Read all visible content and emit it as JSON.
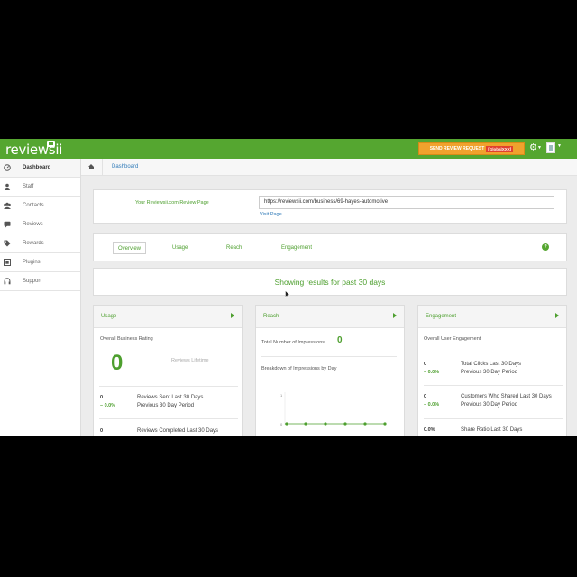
{
  "header": {
    "logo": "reviewsii",
    "send_button": "SEND REVIEW REQUEST",
    "send_tag": "[GlobalXXX]"
  },
  "sidebar": {
    "items": [
      {
        "label": "Dashboard",
        "icon": "dashboard-icon"
      },
      {
        "label": "Staff",
        "icon": "user-icon"
      },
      {
        "label": "Contacts",
        "icon": "contacts-icon"
      },
      {
        "label": "Reviews",
        "icon": "chat-icon"
      },
      {
        "label": "Rewards",
        "icon": "tag-icon"
      },
      {
        "label": "Plugins",
        "icon": "plugin-icon"
      },
      {
        "label": "Support",
        "icon": "headset-icon"
      }
    ]
  },
  "breadcrumb": {
    "current": "Dashboard"
  },
  "review_page": {
    "label": "Your Reviewsii.com Review Page",
    "url": "https://reviewsii.com/business/69-hayes-automotive",
    "visit": "Visit Page"
  },
  "tabs": [
    "Overview",
    "Usage",
    "Reach",
    "Engagement"
  ],
  "results_text": "Showing results for past 30 days",
  "usage": {
    "title": "Usage",
    "rating_label": "Overall Business Rating",
    "rating_value": "0",
    "lifetime_label": "Reviews Lifetime",
    "stat1_num": "0",
    "stat1_delta": "0.0%",
    "stat1_line1": "Reviews Sent Last 30 Days",
    "stat1_line2": "Previous 30 Day Period",
    "stat2_num": "0",
    "stat2_line1": "Reviews Completed Last 30 Days"
  },
  "reach": {
    "title": "Reach",
    "impressions_label": "Total Number of Impressions",
    "impressions_value": "0",
    "breakdown_label": "Breakdown of Impressions by Day",
    "y_top": "1",
    "y_bottom": "0"
  },
  "engagement": {
    "title": "Engagement",
    "overall_label": "Overall User Engagement",
    "stat1_num": "0",
    "stat1_delta": "0.0%",
    "stat1_line1": "Total Clicks Last 30 Days",
    "stat1_line2": "Previous 30 Day Period",
    "stat2_num": "0",
    "stat2_delta": "0.0%",
    "stat2_line1": "Customers Who Shared Last 30 Days",
    "stat2_line2": "Previous 30 Day Period",
    "stat3_num": "0.0%",
    "stat3_line1": "Share Ratio Last 30 Days"
  },
  "colors": {
    "brand": "#55a630",
    "accent": "#f0a22d",
    "link": "#2f7ab8"
  }
}
